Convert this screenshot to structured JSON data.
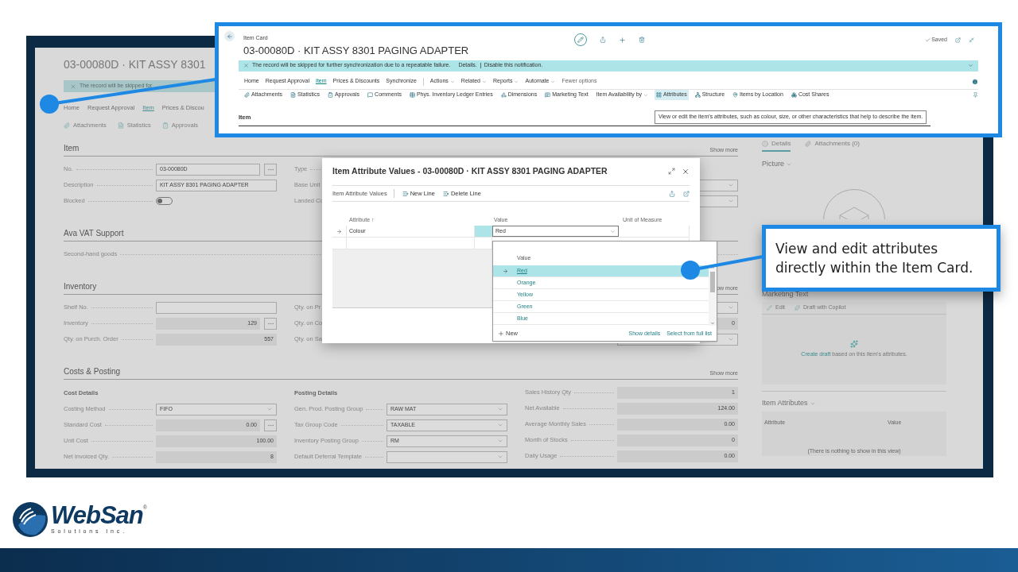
{
  "page": {
    "title": "03-00080D · KIT ASSY 8301",
    "notification": "The record will be skipped for",
    "action_tabs": [
      {
        "label": "Home",
        "selected": false
      },
      {
        "label": "Request Approval",
        "selected": false
      },
      {
        "label": "Item",
        "selected": true
      },
      {
        "label": "Prices & Discou",
        "selected": false
      }
    ],
    "toolbar": [
      "Attachments",
      "Statistics",
      "Approvals"
    ],
    "sections": [
      {
        "title": "Item",
        "show_more": "Show more",
        "columns": [
          {
            "rows": [
              {
                "label": "No.",
                "value": "03-00080D",
                "kind": "assist"
              },
              {
                "label": "Description",
                "value": "KIT ASSY 8301 PAGING ADAPTER",
                "kind": "text"
              },
              {
                "label": "Blocked",
                "kind": "toggle",
                "on": false
              }
            ]
          },
          {
            "rows": [
              {
                "label": "Type",
                "kind": "none"
              },
              {
                "label": "Base Unit",
                "kind": "none"
              },
              {
                "label": "Landed Co",
                "kind": "none"
              }
            ]
          },
          {
            "rows": [
              {
                "kind": "blank"
              },
              {
                "kind": "dropdown"
              },
              {
                "kind": "dropdown"
              }
            ]
          }
        ]
      },
      {
        "title": "Ava VAT Support",
        "columns": [
          {
            "rows": [
              {
                "label": "Second-hand goods",
                "kind": "none"
              }
            ]
          }
        ]
      },
      {
        "title": "Inventory",
        "show_more": "ow more",
        "columns": [
          {
            "rows": [
              {
                "label": "Shelf No.",
                "kind": "text"
              },
              {
                "label": "Inventory",
                "value": "129",
                "kind": "readonly_assist"
              },
              {
                "label": "Qty. on Purch. Order",
                "value": "557",
                "kind": "readonly"
              }
            ]
          },
          {
            "rows": [
              {
                "label": "Qty. on Pr",
                "kind": "none"
              },
              {
                "label": "Qty. on Co",
                "kind": "none"
              },
              {
                "label": "Qty. on Sa",
                "kind": "none"
              }
            ]
          },
          {
            "rows": [
              {
                "kind": "dropdown"
              },
              {
                "kind": "readonly",
                "value": "0"
              },
              {
                "kind": "dropdown"
              }
            ]
          }
        ]
      },
      {
        "title": "Costs & Posting",
        "show_more": "Show more",
        "columns": [
          {
            "subtitle": "Cost Details",
            "rows": [
              {
                "label": "Costing Method",
                "value": "FIFO",
                "kind": "dropdown"
              },
              {
                "label": "Standard Cost",
                "value": "0.00",
                "kind": "readonly_assist"
              },
              {
                "label": "Unit Cost",
                "value": "100.00",
                "kind": "readonly"
              },
              {
                "label": "Net Invoiced Qty.",
                "value": "8",
                "kind": "readonly"
              }
            ]
          },
          {
            "subtitle": "Posting Details",
            "rows": [
              {
                "label": "Gen. Prod. Posting Group",
                "value": "RAW MAT",
                "kind": "dropdown"
              },
              {
                "label": "Tax Group Code",
                "value": "TAXABLE",
                "kind": "dropdown"
              },
              {
                "label": "Inventory Posting Group",
                "value": "RM",
                "kind": "dropdown"
              },
              {
                "label": "Default Deferral Template",
                "kind": "dropdown"
              }
            ]
          },
          {
            "rows": [
              {
                "label": "Sales History Qty",
                "value": "1",
                "kind": "readonly"
              },
              {
                "label": "Net Available",
                "value": "124.00",
                "kind": "readonly"
              },
              {
                "label": "Average Monthly Sales",
                "value": "0.00",
                "kind": "readonly"
              },
              {
                "label": "Month of Stocks",
                "value": "0",
                "kind": "readonly"
              },
              {
                "label": "Daily Usage",
                "value": "0.00",
                "kind": "readonly"
              }
            ]
          }
        ]
      }
    ]
  },
  "factbox": {
    "tabs": [
      {
        "label": "Details",
        "selected": true
      },
      {
        "label": "Attachments (0)",
        "selected": false
      }
    ],
    "picture_title": "Picture",
    "marketing_title": "Marketing Text",
    "marketing_actions": [
      "Edit",
      "Draft with Copilot"
    ],
    "draft_link": "Create draft",
    "draft_text": "based on this item's attributes.",
    "attributes_title": "Item Attributes",
    "attributes_columns": [
      "Attribute",
      "Value"
    ],
    "empty_text": "(There is nothing to show in this view)"
  },
  "zoom_callout": {
    "breadcrumb": "Item Card",
    "title": "03-00080D · KIT ASSY 8301 PAGING ADAPTER",
    "saved": "Saved",
    "notification": "The record will be skipped for further synchronization due to a repeatable failure.",
    "notification_links": [
      "Details.",
      "Disable this notification."
    ],
    "action_tabs": [
      {
        "label": "Home",
        "selected": false
      },
      {
        "label": "Request Approval",
        "selected": false
      },
      {
        "label": "Item",
        "selected": true
      },
      {
        "label": "Prices & Discounts",
        "selected": false
      },
      {
        "label": "Synchronize",
        "selected": false
      }
    ],
    "menus": [
      "Actions",
      "Related",
      "Reports",
      "Automate"
    ],
    "fewer_options": "Fewer options",
    "toolbar": [
      {
        "label": "Attachments",
        "selected": false,
        "menu": false
      },
      {
        "label": "Statistics",
        "selected": false,
        "menu": false
      },
      {
        "label": "Approvals",
        "selected": false,
        "menu": false
      },
      {
        "label": "Comments",
        "selected": false,
        "menu": false
      },
      {
        "label": "Phys. Inventory Ledger Entries",
        "selected": false,
        "menu": false
      },
      {
        "label": "Dimensions",
        "selected": false,
        "menu": false
      },
      {
        "label": "Marketing Text",
        "selected": false,
        "menu": false
      },
      {
        "label": "Item Availability by",
        "selected": false,
        "menu": true
      },
      {
        "label": "Attributes",
        "selected": true,
        "menu": false
      },
      {
        "label": "Structure",
        "selected": false,
        "menu": false
      },
      {
        "label": "Items by Location",
        "selected": false,
        "menu": false
      },
      {
        "label": "Cost Shares",
        "selected": false,
        "menu": false
      }
    ],
    "section_title": "Item",
    "tooltip": "View or edit the item's attributes, such as colour, size, or other characteristics that help to describe the item."
  },
  "dialog": {
    "title": "Item Attribute Values - 03-00080D · KIT ASSY 8301 PAGING ADAPTER",
    "page_caption": "Item Attribute Values",
    "actions": [
      "New Line",
      "Delete Line"
    ],
    "columns": [
      "Attribute ↑",
      "Value",
      "Unit of Measure"
    ],
    "rows": [
      {
        "attribute": "Colour",
        "value": "Red",
        "current": true
      },
      {
        "current": false
      }
    ]
  },
  "value_dropdown": {
    "header": "Value",
    "options": [
      {
        "label": "Red",
        "selected": true
      },
      {
        "label": "Orange",
        "selected": false
      },
      {
        "label": "Yellow",
        "selected": false
      },
      {
        "label": "Green",
        "selected": false
      },
      {
        "label": "Blue",
        "selected": false
      }
    ],
    "new": "New",
    "links": [
      "Show details",
      "Select from full list"
    ]
  },
  "callout_text": "View and edit attributes directly within the Item Card.",
  "logo": {
    "name": "WebSan",
    "mark": "®",
    "tagline": "Solutions Inc."
  }
}
